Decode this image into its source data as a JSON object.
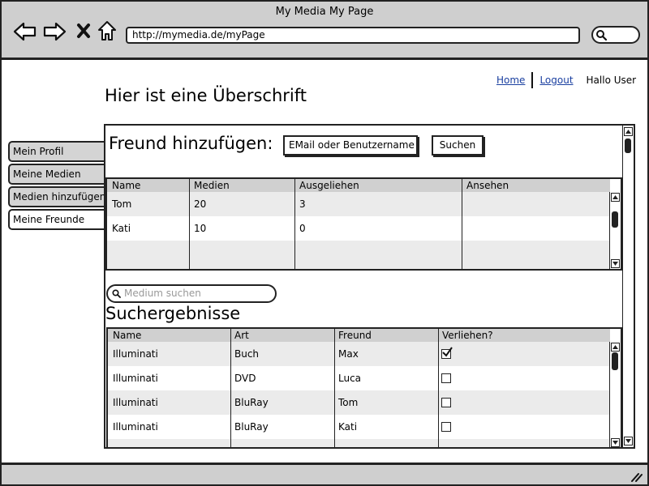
{
  "browser": {
    "window_title": "My Media My Page",
    "url": "http://mymedia.de/myPage",
    "back_icon": "back-arrow-icon",
    "forward_icon": "forward-arrow-icon",
    "stop_icon": "close-icon",
    "home_icon": "home-icon",
    "search_icon": "search-icon"
  },
  "header": {
    "home_link": "Home",
    "logout_link": "Logout",
    "user_greeting": "Hallo User",
    "page_heading": "Hier ist eine Überschrift"
  },
  "sidebar": {
    "items": [
      {
        "label": "Mein Profil",
        "active": false
      },
      {
        "label": "Meine Medien",
        "active": false
      },
      {
        "label": "Medien hinzufügen",
        "active": false
      },
      {
        "label": "Meine Freunde",
        "active": true
      }
    ]
  },
  "add_friend": {
    "label": "Freund hinzufügen:",
    "input_value": "EMail oder Benutzername",
    "search_button": "Suchen"
  },
  "friends_table": {
    "columns": [
      "Name",
      "Medien",
      "Ausgeliehen",
      "Ansehen"
    ],
    "rows": [
      [
        "Tom",
        "20",
        "3",
        ""
      ],
      [
        "Kati",
        "10",
        "0",
        ""
      ]
    ]
  },
  "media_search": {
    "placeholder": "Medium suchen",
    "results_title": "Suchergebnisse"
  },
  "results_table": {
    "columns": [
      "Name",
      "Art",
      "Freund",
      "Verliehen?"
    ],
    "rows": [
      {
        "name": "Illuminati",
        "art": "Buch",
        "freund": "Max",
        "verliehen": true
      },
      {
        "name": "Illuminati",
        "art": "DVD",
        "freund": "Luca",
        "verliehen": false
      },
      {
        "name": "Illuminati",
        "art": "BluRay",
        "freund": "Tom",
        "verliehen": false
      },
      {
        "name": "Illuminati",
        "art": "BluRay",
        "freund": "Kati",
        "verliehen": false
      }
    ]
  },
  "colors": {
    "chrome": "#cfcfcf",
    "tab_inactive": "#d4d4d4",
    "table_header": "#d0d0d0",
    "row_alt": "#ebebeb",
    "link": "#1a3fa0",
    "placeholder": "#999999"
  }
}
